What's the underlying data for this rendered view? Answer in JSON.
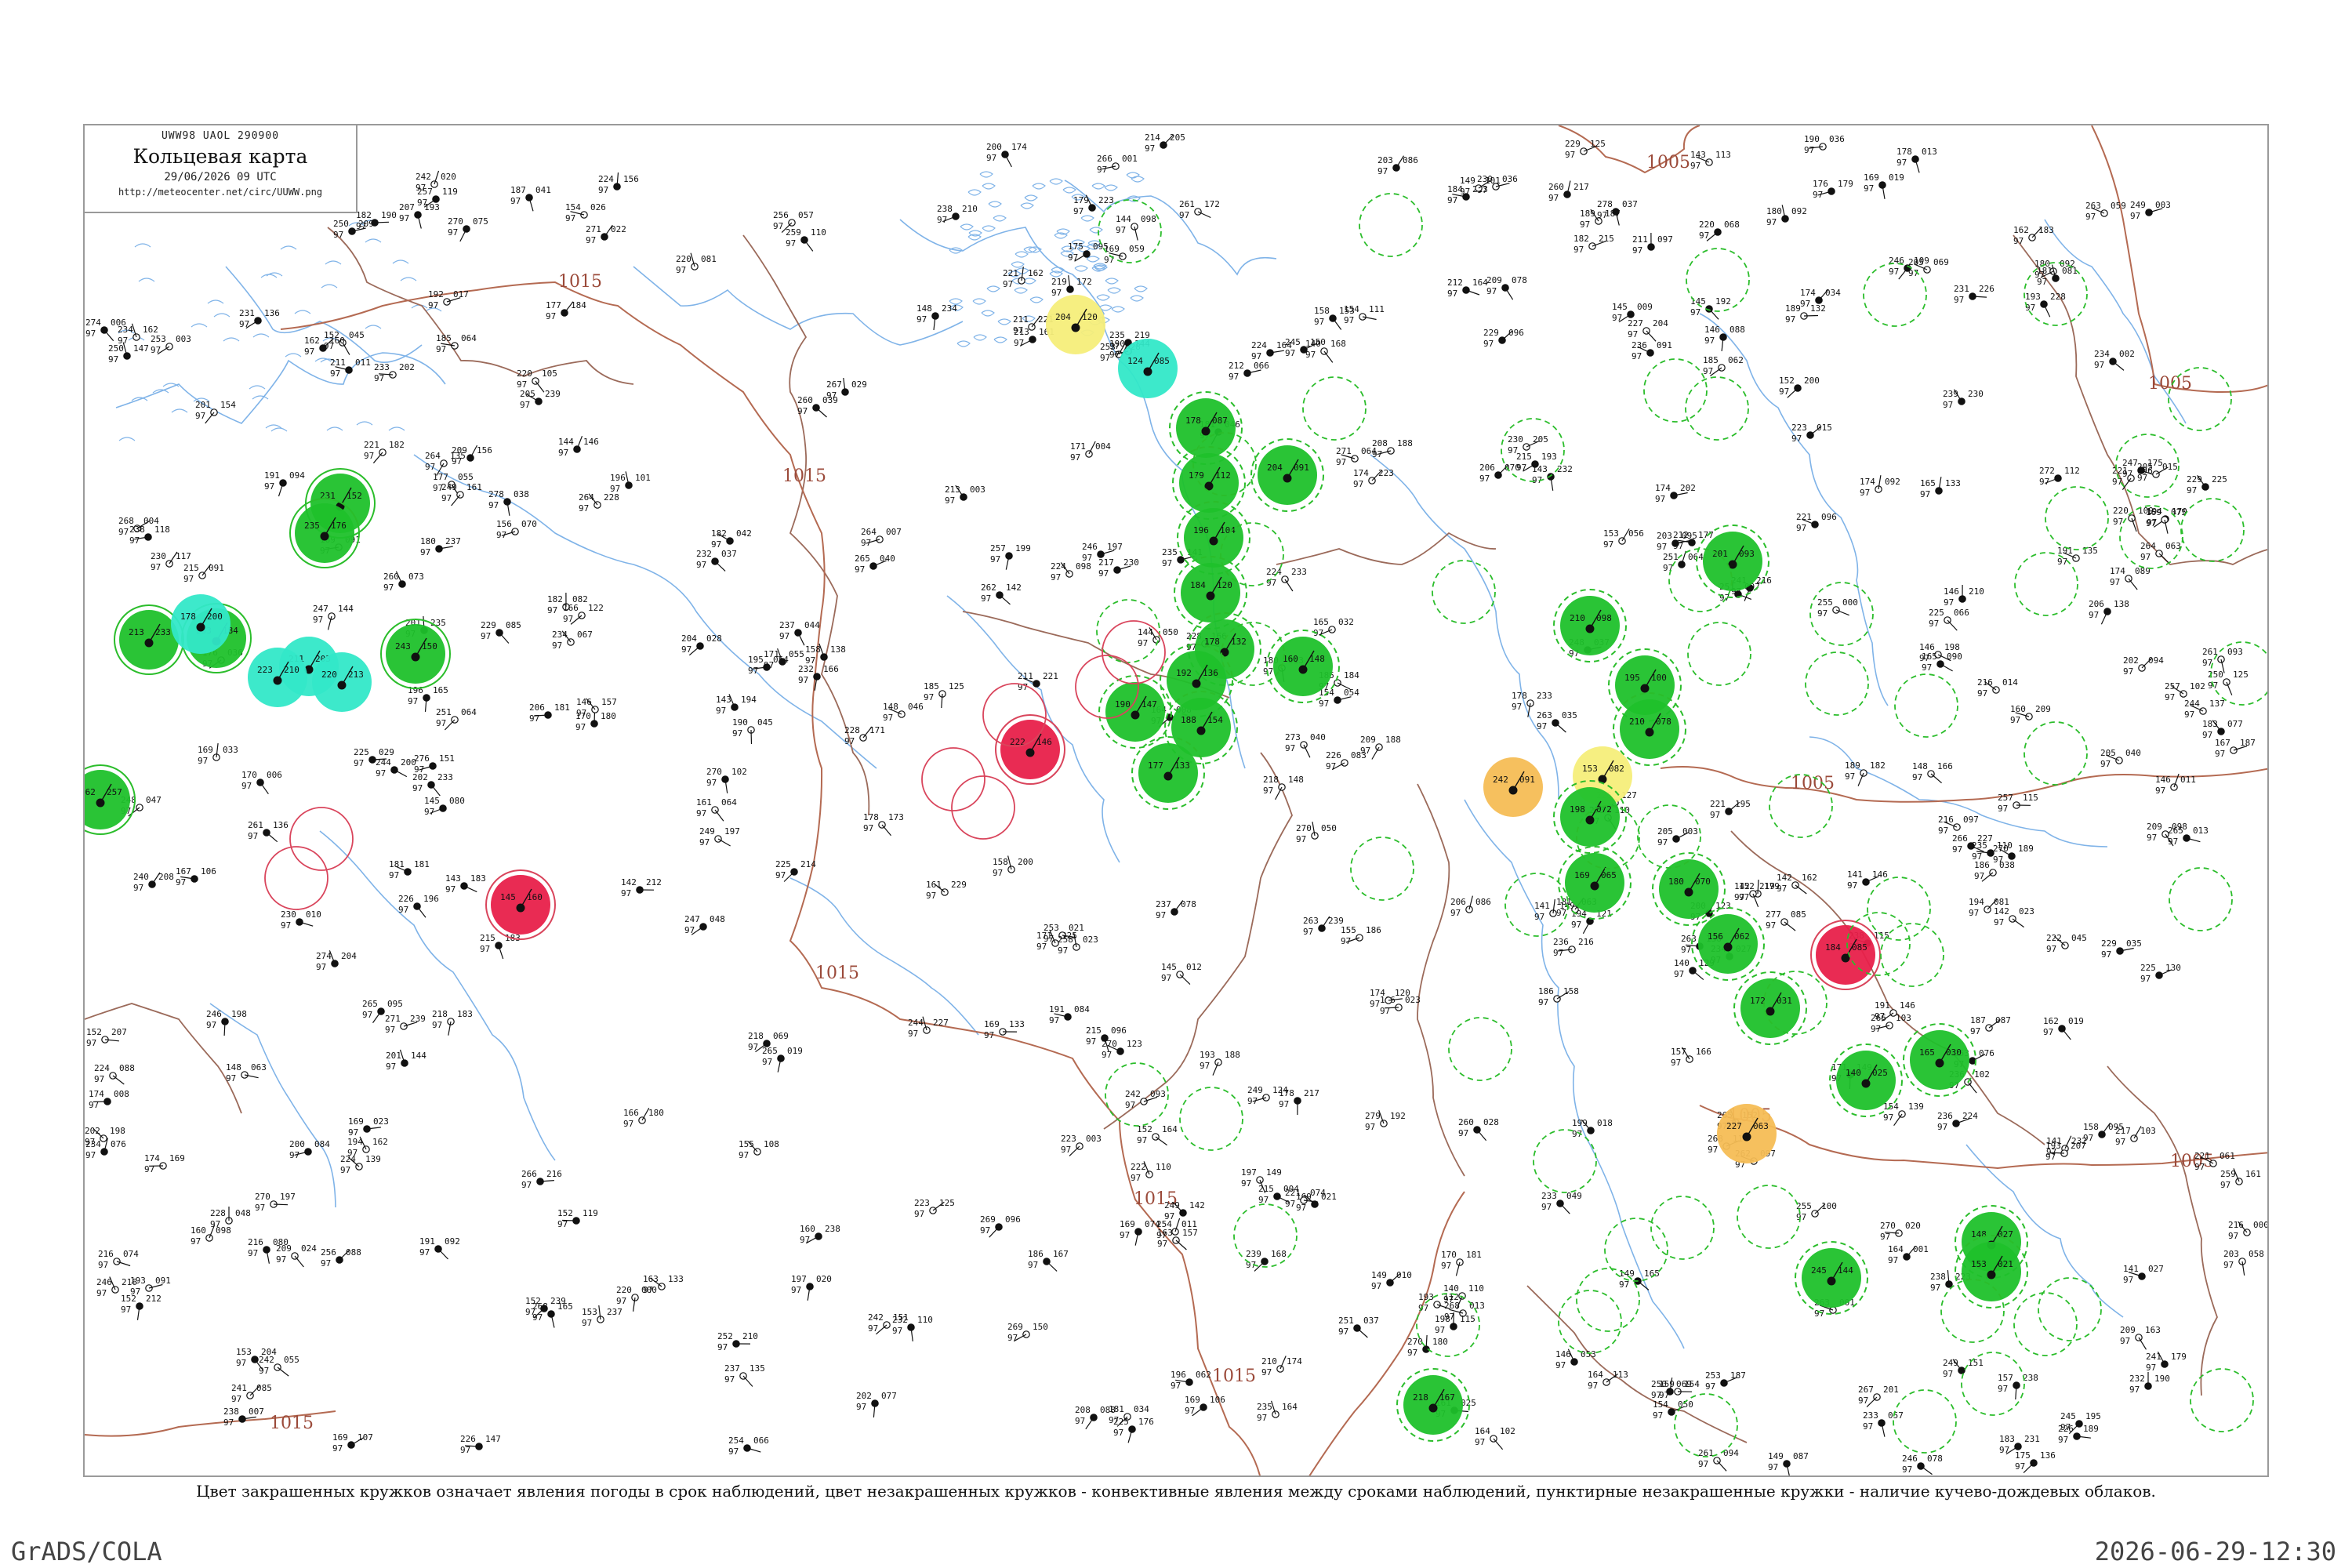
{
  "title": {
    "code": "UWW98 UAOL 290900",
    "name": "Кольцевая карта",
    "time": "29/06/2026 09 UTC",
    "url": "http://meteocenter.net/circ/UUWW.png"
  },
  "isobars": [
    {
      "label": "1015"
    },
    {
      "label": "1015"
    },
    {
      "label": "1015"
    },
    {
      "label": "1015"
    },
    {
      "label": "1015"
    },
    {
      "label": "1015"
    },
    {
      "label": "1005"
    },
    {
      "label": "1005"
    },
    {
      "label": "1005"
    },
    {
      "label": "1005"
    },
    {
      "label": "1005"
    }
  ],
  "legend": {
    "caption": "Цвет закрашенных кружков означает явления погоды в срок наблюдений, цвет незакрашенных кружков - конвективные явления между сроками наблюдений, пунктирные незакрашенные кружки - наличие кучево-дождевых облаков."
  },
  "footer": {
    "left": "GrADS/COLA",
    "right": "2026-06-29-12:30"
  },
  "colors": {
    "rain": "#1fc12b",
    "shower": "#33e8c8",
    "thunderstorm": "#e8204a",
    "fog": "#f6ee7a",
    "haze": "#f5bd55",
    "convective_ring": "#2bbd2b",
    "past_thunder_ring": "#d9455c",
    "river": "#7fb3e8",
    "border": "#9b6a5a"
  },
  "highlight_stations": [
    {
      "phenomenon": "rain",
      "ring": "solid",
      "t": "231",
      "p": "152"
    },
    {
      "phenomenon": "rain",
      "ring": "solid",
      "t": "235",
      "p": "176"
    },
    {
      "phenomenon": "rain",
      "ring": "solid",
      "t": "253",
      "p": "184"
    },
    {
      "phenomenon": "rain",
      "ring": "solid",
      "t": "213",
      "p": "233"
    },
    {
      "phenomenon": "rain",
      "ring": "solid",
      "t": "262",
      "p": "257"
    },
    {
      "phenomenon": "rain",
      "ring": "solid",
      "t": "243",
      "p": "150"
    },
    {
      "phenomenon": "shower",
      "ring": "none",
      "t": "178",
      "p": "200"
    },
    {
      "phenomenon": "shower",
      "ring": "none",
      "t": "211",
      "p": "203"
    },
    {
      "phenomenon": "shower",
      "ring": "none",
      "t": "220",
      "p": "213"
    },
    {
      "phenomenon": "shower",
      "ring": "none",
      "t": "223",
      "p": "210"
    },
    {
      "phenomenon": "thunderstorm",
      "ring": "solid",
      "t": "145",
      "p": "160"
    },
    {
      "phenomenon": "thunderstorm",
      "ring": "solid",
      "t": "222",
      "p": "146"
    },
    {
      "phenomenon": "thunderstorm",
      "ring": "solid",
      "t": "184",
      "p": "085"
    },
    {
      "phenomenon": "fog",
      "ring": "none",
      "t": "204",
      "p": "120"
    },
    {
      "phenomenon": "fog",
      "ring": "none",
      "t": "153",
      "p": "082"
    },
    {
      "phenomenon": "haze",
      "ring": "none",
      "t": "242",
      "p": "091"
    },
    {
      "phenomenon": "haze",
      "ring": "none",
      "t": "227",
      "p": "063"
    },
    {
      "phenomenon": "shower",
      "ring": "none",
      "t": "124",
      "p": "085"
    },
    {
      "phenomenon": "rain",
      "ring": "dashed",
      "t": "178",
      "p": "087"
    },
    {
      "phenomenon": "rain",
      "ring": "dashed",
      "t": "179",
      "p": "112"
    },
    {
      "phenomenon": "rain",
      "ring": "dashed",
      "t": "196",
      "p": "104"
    },
    {
      "phenomenon": "rain",
      "ring": "dashed",
      "t": "184",
      "p": "120"
    },
    {
      "phenomenon": "rain",
      "ring": "dashed",
      "t": "178",
      "p": "132"
    },
    {
      "phenomenon": "rain",
      "ring": "dashed",
      "t": "192",
      "p": "136"
    },
    {
      "phenomenon": "rain",
      "ring": "dashed",
      "t": "190",
      "p": "147"
    },
    {
      "phenomenon": "rain",
      "ring": "dashed",
      "t": "188",
      "p": "154"
    },
    {
      "phenomenon": "rain",
      "ring": "dashed",
      "t": "160",
      "p": "148"
    },
    {
      "phenomenon": "rain",
      "ring": "dashed",
      "t": "177",
      "p": "133"
    },
    {
      "phenomenon": "rain",
      "ring": "dashed",
      "t": "204",
      "p": "091"
    },
    {
      "phenomenon": "rain",
      "ring": "dashed",
      "t": "201",
      "p": "093"
    },
    {
      "phenomenon": "rain",
      "ring": "dashed",
      "t": "210",
      "p": "098"
    },
    {
      "phenomenon": "rain",
      "ring": "dashed",
      "t": "195",
      "p": "100"
    },
    {
      "phenomenon": "rain",
      "ring": "dashed",
      "t": "210",
      "p": "078"
    },
    {
      "phenomenon": "rain",
      "ring": "dashed",
      "t": "198",
      "p": "072"
    },
    {
      "phenomenon": "rain",
      "ring": "dashed",
      "t": "180",
      "p": "070"
    },
    {
      "phenomenon": "rain",
      "ring": "dashed",
      "t": "169",
      "p": "065"
    },
    {
      "phenomenon": "rain",
      "ring": "dashed",
      "t": "156",
      "p": "062"
    },
    {
      "phenomenon": "rain",
      "ring": "dashed",
      "t": "172",
      "p": "031"
    },
    {
      "phenomenon": "rain",
      "ring": "dashed",
      "t": "148",
      "p": "027"
    },
    {
      "phenomenon": "rain",
      "ring": "dashed",
      "t": "153",
      "p": "021"
    },
    {
      "phenomenon": "rain",
      "ring": "dashed",
      "t": "165",
      "p": "030"
    },
    {
      "phenomenon": "rain",
      "ring": "dashed",
      "t": "140",
      "p": "025"
    },
    {
      "phenomenon": "rain",
      "ring": "dashed",
      "t": "218",
      "p": "167"
    },
    {
      "phenomenon": "rain",
      "ring": "dashed",
      "t": "245",
      "p": "144"
    }
  ]
}
